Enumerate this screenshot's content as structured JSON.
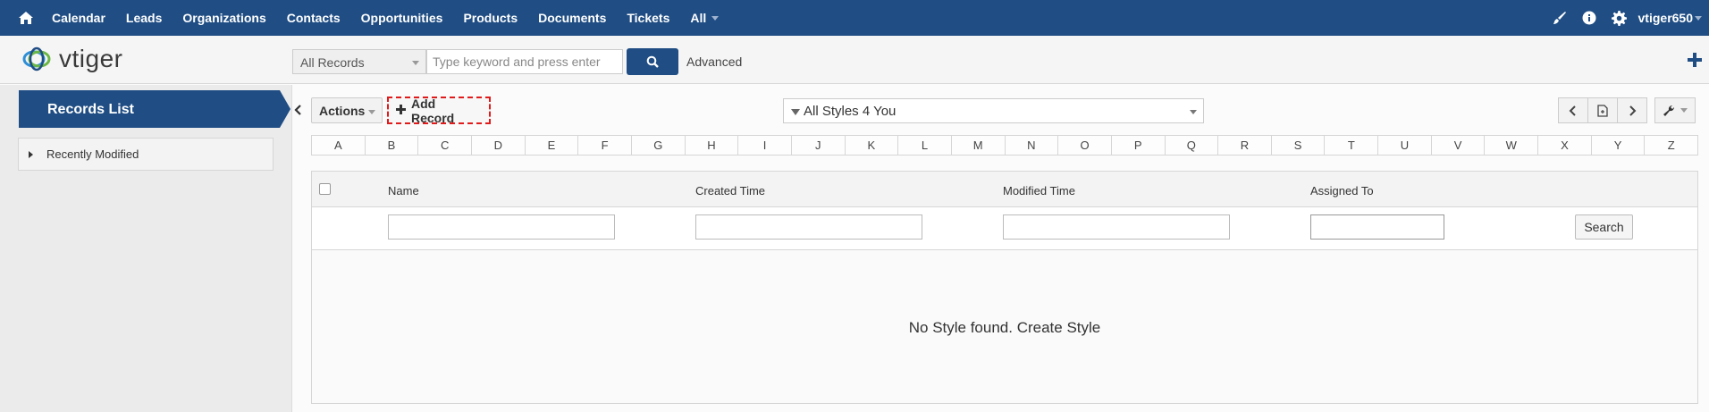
{
  "nav": {
    "menu": [
      "Calendar",
      "Leads",
      "Organizations",
      "Contacts",
      "Opportunities",
      "Products",
      "Documents",
      "Tickets"
    ],
    "all_label": "All",
    "username": "vtiger650"
  },
  "header": {
    "logo_text": "vtiger",
    "scope_selected": "All Records",
    "search_placeholder": "Type keyword and press enter",
    "advanced_label": "Advanced"
  },
  "sidebar": {
    "records_list_label": "Records List",
    "recently_modified_label": "Recently Modified"
  },
  "toolbar": {
    "actions_label": "Actions",
    "add_record_label": "Add Record",
    "filter_selected": "All Styles 4 You"
  },
  "alphabet": [
    "A",
    "B",
    "C",
    "D",
    "E",
    "F",
    "G",
    "H",
    "I",
    "J",
    "K",
    "L",
    "M",
    "N",
    "O",
    "P",
    "Q",
    "R",
    "S",
    "T",
    "U",
    "V",
    "W",
    "X",
    "Y",
    "Z"
  ],
  "table": {
    "columns": [
      "Name",
      "Created Time",
      "Modified Time",
      "Assigned To"
    ],
    "search_label": "Search",
    "empty_message": "No Style found. Create Style"
  },
  "colors": {
    "brand": "#1f4d84",
    "highlight_dash": "#e01b1b"
  }
}
